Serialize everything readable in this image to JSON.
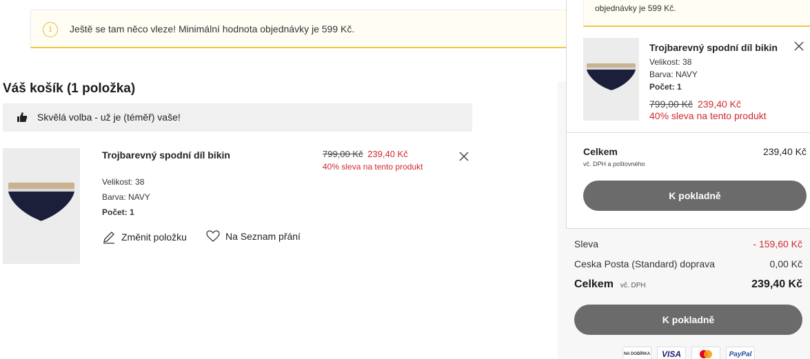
{
  "notice": {
    "text": "Ještě se tam něco vleze! Minimální hodnota objednávky je 599 Kč."
  },
  "cart": {
    "title": "Váš košík (1 položka)",
    "good_choice": "Skvělá volba - už je (téměř) vaše!",
    "item": {
      "name": "Trojbarevný spodní díl bikin",
      "old_price": "799,00 Kč",
      "new_price": "239,40 Kč",
      "discount": "40% sleva na tento produkt",
      "size": "Velikost: 38",
      "color": "Barva: NAVY",
      "qty": "Počet: 1",
      "edit_label": "Změnit položku",
      "wishlist_label": "Na Seznam přání"
    }
  },
  "summary": {
    "discount_label": "Sleva",
    "discount_value": "- 159,60 Kč",
    "shipping_label": "Ceska Posta (Standard) doprava",
    "shipping_value": "0,00 Kč",
    "total_label": "Celkem",
    "total_vat": "vč. DPH",
    "total_value": "239,40 Kč",
    "checkout_label": "K pokladně",
    "payment_methods": [
      "NA DOBÍRKA",
      "VISA",
      "Mastercard",
      "PayPal"
    ]
  },
  "mini_cart": {
    "notice_text": "objednávky je 599 Kč.",
    "item_name": "Trojbarevný spodní díl bikin",
    "size": "Velikost: 38",
    "color": "Barva: NAVY",
    "qty": "Počet: 1",
    "old_price": "799,00 Kč",
    "new_price": "239,40 Kč",
    "discount": "40% sleva na tento produkt",
    "total_label": "Celkem",
    "total_value": "239,40 Kč",
    "vat_note": "vč. DPH a poštovného",
    "checkout_label": "K pokladně"
  },
  "colors": {
    "accent_yellow": "#f0c640",
    "sale_red": "#d0282e",
    "button_gray": "#6b6b6b"
  }
}
